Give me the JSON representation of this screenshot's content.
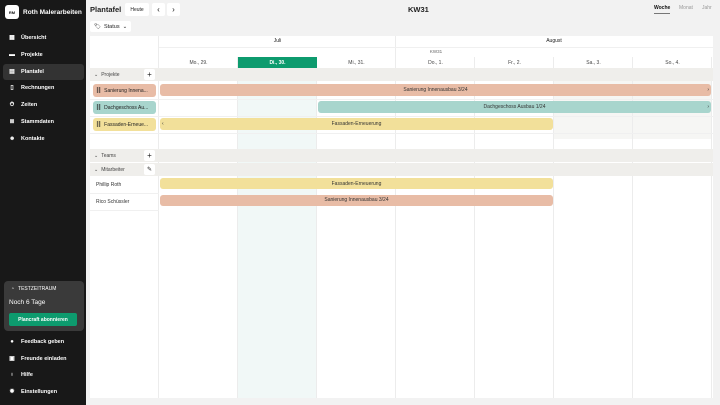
{
  "sidebar": {
    "logo": "RM",
    "company": "Roth Malerarbeiten",
    "items": [
      {
        "label": "Übersicht",
        "icon": "grid-icon"
      },
      {
        "label": "Projekte",
        "icon": "folder-icon"
      },
      {
        "label": "Plantafel",
        "icon": "calendar-icon",
        "active": true
      },
      {
        "label": "Rechnungen",
        "icon": "invoice-icon"
      },
      {
        "label": "Zeiten",
        "icon": "stopwatch-icon"
      },
      {
        "label": "Stammdaten",
        "icon": "database-icon"
      },
      {
        "label": "Kontakte",
        "icon": "contacts-icon"
      }
    ],
    "trial": {
      "label": "TESTZEITRAUM",
      "remaining": "Noch 6 Tage",
      "button": "Plancraft abonnieren"
    },
    "bottom": [
      {
        "label": "Feedback geben",
        "icon": "chat-icon"
      },
      {
        "label": "Freunde einladen",
        "icon": "gift-icon"
      },
      {
        "label": "Hilfe",
        "icon": "lightbulb-icon"
      },
      {
        "label": "Einstellungen",
        "icon": "gear-icon"
      }
    ]
  },
  "toolbar": {
    "title": "Plantafel",
    "today": "Heute",
    "prev": "‹",
    "next": "›",
    "week": "KW31",
    "views": [
      "Woche",
      "Monat",
      "Jahr"
    ],
    "status": "Status"
  },
  "calendar": {
    "months": [
      "Juli",
      "August"
    ],
    "kw": "KW31",
    "days": [
      "Mo., 29.",
      "Di., 30.",
      "Mi., 31.",
      "Do., 1.",
      "Fr., 2.",
      "Sa., 3.",
      "So., 4."
    ],
    "today_index": 1,
    "groups": {
      "projects": "Projekte",
      "teams": "Teams",
      "employees": "Mitarbeiter"
    },
    "projects": [
      {
        "chip": "Sanierung Innena...",
        "bar": "Sanierung Innenausbau 3/24",
        "color": "#e8bca6"
      },
      {
        "chip": "Dachgeschoss Au...",
        "bar": "Dachgeschoss Ausbau 1/24",
        "color": "#a8d5cd"
      },
      {
        "chip": "Fassaden-Erneue...",
        "bar": "Fassaden-Erneuerung",
        "color": "#f2e09a"
      }
    ],
    "employees": [
      {
        "name": "Phillip Roth",
        "bar": "Fassaden-Erneuerung",
        "color": "#f2e09a"
      },
      {
        "name": "Rico Schüssler",
        "bar": "Sanierung Innenausbau 3/24",
        "color": "#e8bca6"
      }
    ]
  },
  "colors": {
    "accent": "#0d9b6e",
    "sidebar": "#181818"
  }
}
